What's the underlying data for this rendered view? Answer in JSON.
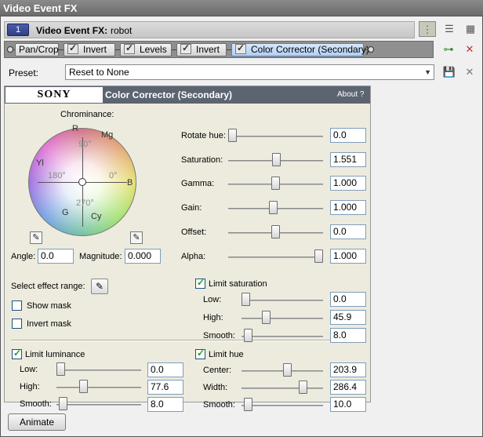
{
  "window": {
    "title": "Video Event FX"
  },
  "header": {
    "chain_number": "1",
    "label": "Video Event FX:",
    "event_name": "robot"
  },
  "toolbar_icons": [
    "grip-icon",
    "list-view-icon",
    "grid-view-icon"
  ],
  "chain": {
    "plugins": [
      {
        "label": "Pan/Crop",
        "checkbox": false,
        "active": false
      },
      {
        "label": "Invert",
        "checkbox": true,
        "active": false
      },
      {
        "label": "Levels",
        "checkbox": true,
        "active": false
      },
      {
        "label": "Invert",
        "checkbox": true,
        "active": false
      },
      {
        "label": "Color Corrector (Secondary)",
        "checkbox": true,
        "active": true
      }
    ],
    "icons": [
      "plug-in-chain-icon",
      "remove-plug-in-icon"
    ]
  },
  "preset": {
    "label": "Preset:",
    "value": "Reset to None",
    "icons": [
      "save-preset-icon",
      "delete-preset-icon"
    ]
  },
  "panel": {
    "brand": "SONY",
    "title": "Color Corrector (Secondary)",
    "about": "About ?",
    "chrominance": {
      "label": "Chrominance:",
      "wheel_labels": {
        "r": "R",
        "mg": "Mg",
        "yl": "Yl",
        "b": "B",
        "g": "G",
        "cy": "Cy"
      },
      "degrees": {
        "d90": "90°",
        "d180": "180°",
        "d0": "0°",
        "d270": "270°"
      },
      "angle_label": "Angle:",
      "angle_value": "0.0",
      "magnitude_label": "Magnitude:",
      "magnitude_value": "0.000"
    },
    "sliders": {
      "rotate_hue": {
        "label": "Rotate hue:",
        "value": "0.0",
        "level": 0.0
      },
      "saturation": {
        "label": "Saturation:",
        "value": "1.551",
        "level": 0.51
      },
      "gamma": {
        "label": "Gamma:",
        "value": "1.000",
        "level": 0.5
      },
      "gain": {
        "label": "Gain:",
        "value": "1.000",
        "level": 0.47
      },
      "offset": {
        "label": "Offset:",
        "value": "0.0",
        "level": 0.5
      },
      "alpha": {
        "label": "Alpha:",
        "value": "1.000",
        "level": 1.0
      }
    },
    "effect_range": {
      "label": "Select effect range:",
      "show_mask": "Show mask",
      "invert_mask": "Invert mask"
    },
    "limit_luminance": {
      "label": "Limit luminance",
      "checked": true,
      "low": {
        "label": "Low:",
        "value": "0.0",
        "level": 0.0
      },
      "high": {
        "label": "High:",
        "value": "77.6",
        "level": 0.3
      },
      "smooth": {
        "label": "Smooth:",
        "value": "8.0",
        "level": 0.03
      }
    },
    "limit_saturation": {
      "label": "Limit saturation",
      "checked": true,
      "low": {
        "label": "Low:",
        "value": "0.0",
        "level": 0.0
      },
      "high": {
        "label": "High:",
        "value": "45.9",
        "level": 0.28
      },
      "smooth": {
        "label": "Smooth:",
        "value": "8.0",
        "level": 0.03
      }
    },
    "limit_hue": {
      "label": "Limit hue",
      "checked": true,
      "center": {
        "label": "Center:",
        "value": "203.9",
        "level": 0.57
      },
      "width": {
        "label": "Width:",
        "value": "286.4",
        "level": 0.78
      },
      "smooth": {
        "label": "Smooth:",
        "value": "10.0",
        "level": 0.03
      }
    }
  },
  "animate_label": "Animate"
}
